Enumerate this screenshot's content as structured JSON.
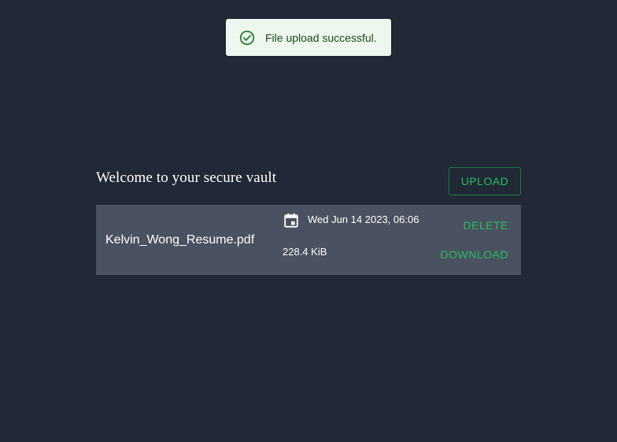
{
  "toast": {
    "message": "File upload successful.",
    "icon": "check-circle-icon",
    "background": "#edf7ed",
    "color": "#1e4620"
  },
  "vault": {
    "title": "Welcome to your secure vault",
    "upload_label": "UPLOAD"
  },
  "files": [
    {
      "name": "Kelvin_Wong_Resume.pdf",
      "date": "Wed Jun 14 2023, 06:06",
      "size": "228.4 KiB",
      "date_icon": "calendar-icon",
      "delete_label": "DELETE",
      "download_label": "DOWNLOAD"
    }
  ],
  "colors": {
    "background": "#212836",
    "card": "#4a5160",
    "accent": "#22c062"
  }
}
